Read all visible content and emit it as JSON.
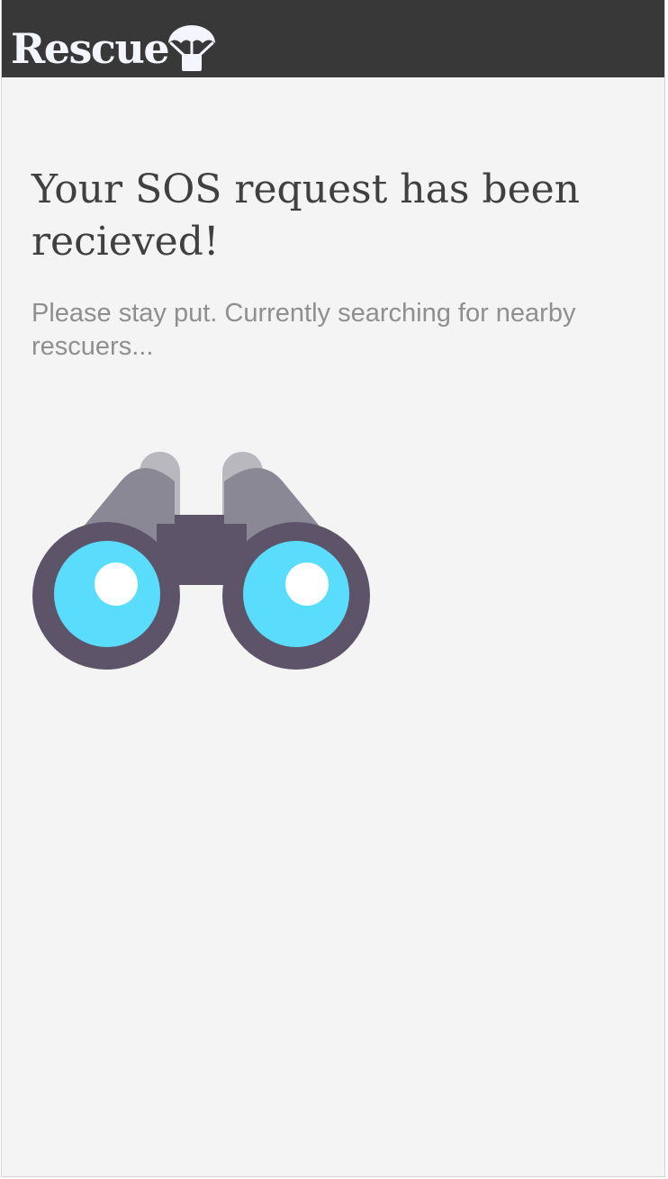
{
  "header": {
    "app_title": "Rescue",
    "logo_icon": "parachute-icon",
    "background_color": "#383838"
  },
  "main": {
    "headline": "Your SOS request has been recieved!",
    "status_text": "Please stay put. Currently searching for nearby rescuers...",
    "illustration_icon": "binoculars-icon",
    "background_color": "#f4f4f4"
  },
  "colors": {
    "lens": "#5adcfd",
    "binocular_body": "#5d5469",
    "binocular_barrel": "#8b8895"
  }
}
